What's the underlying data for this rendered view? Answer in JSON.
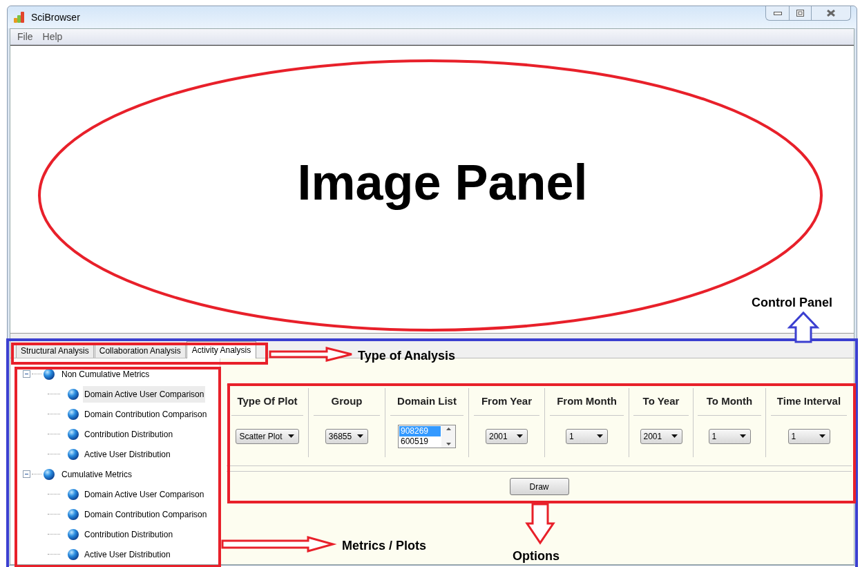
{
  "window": {
    "title": "SciBrowser"
  },
  "menu": [
    "File",
    "Help"
  ],
  "image_panel": {
    "label": "Image Panel"
  },
  "tabs": [
    {
      "label": "Structural Analysis",
      "selected": false
    },
    {
      "label": "Collaboration Analysis",
      "selected": false
    },
    {
      "label": "Activity Analysis",
      "selected": true
    }
  ],
  "tree": [
    {
      "label": "Non Cumulative Metrics",
      "expanded": true,
      "children": [
        {
          "label": "Domain Active User Comparison",
          "selected": true
        },
        {
          "label": "Domain Contribution Comparison",
          "selected": false
        },
        {
          "label": "Contribution Distribution",
          "selected": false
        },
        {
          "label": "Active User Distribution",
          "selected": false
        }
      ]
    },
    {
      "label": "Cumulative Metrics",
      "expanded": true,
      "children": [
        {
          "label": "Domain Active User Comparison",
          "selected": false
        },
        {
          "label": "Domain Contribution Comparison",
          "selected": false
        },
        {
          "label": "Contribution Distribution",
          "selected": false
        },
        {
          "label": "Active User Distribution",
          "selected": false
        }
      ]
    }
  ],
  "options": {
    "columns": [
      {
        "heading": "Type Of Plot",
        "kind": "dropdown",
        "value": "Scatter Plot"
      },
      {
        "heading": "Group",
        "kind": "dropdown",
        "value": "36855"
      },
      {
        "heading": "Domain List",
        "kind": "listbox",
        "items": [
          {
            "label": "908269",
            "selected": true
          },
          {
            "label": "600519",
            "selected": false
          }
        ]
      },
      {
        "heading": "From Year",
        "kind": "dropdown",
        "value": "2001"
      },
      {
        "heading": "From Month",
        "kind": "dropdown",
        "value": "1"
      },
      {
        "heading": "To Year",
        "kind": "dropdown",
        "value": "2001"
      },
      {
        "heading": "To Month",
        "kind": "dropdown",
        "value": "1"
      },
      {
        "heading": "Time Interval",
        "kind": "dropdown",
        "value": "1"
      }
    ],
    "button": "Draw"
  },
  "annotations": [
    {
      "kind": "ellipse",
      "color": "#e8202a"
    },
    {
      "kind": "box",
      "color": "#3b3fd0"
    },
    {
      "kind": "box",
      "color": "#e8202a"
    },
    {
      "kind": "box",
      "color": "#e8202a"
    },
    {
      "kind": "box",
      "color": "#e8202a"
    },
    {
      "kind": "rightarrow",
      "color": "#e8202a"
    },
    {
      "kind": "rightarrow",
      "color": "#e8202a"
    },
    {
      "kind": "downarrow",
      "color": "#e8202a"
    },
    {
      "kind": "uparrow",
      "color": "#3b3fd0"
    },
    {
      "kind": "label",
      "text": "Control Panel"
    },
    {
      "kind": "label",
      "text": "Type of Analysis"
    },
    {
      "kind": "label",
      "text": "Metrics / Plots"
    },
    {
      "kind": "label",
      "text": "Options"
    }
  ]
}
